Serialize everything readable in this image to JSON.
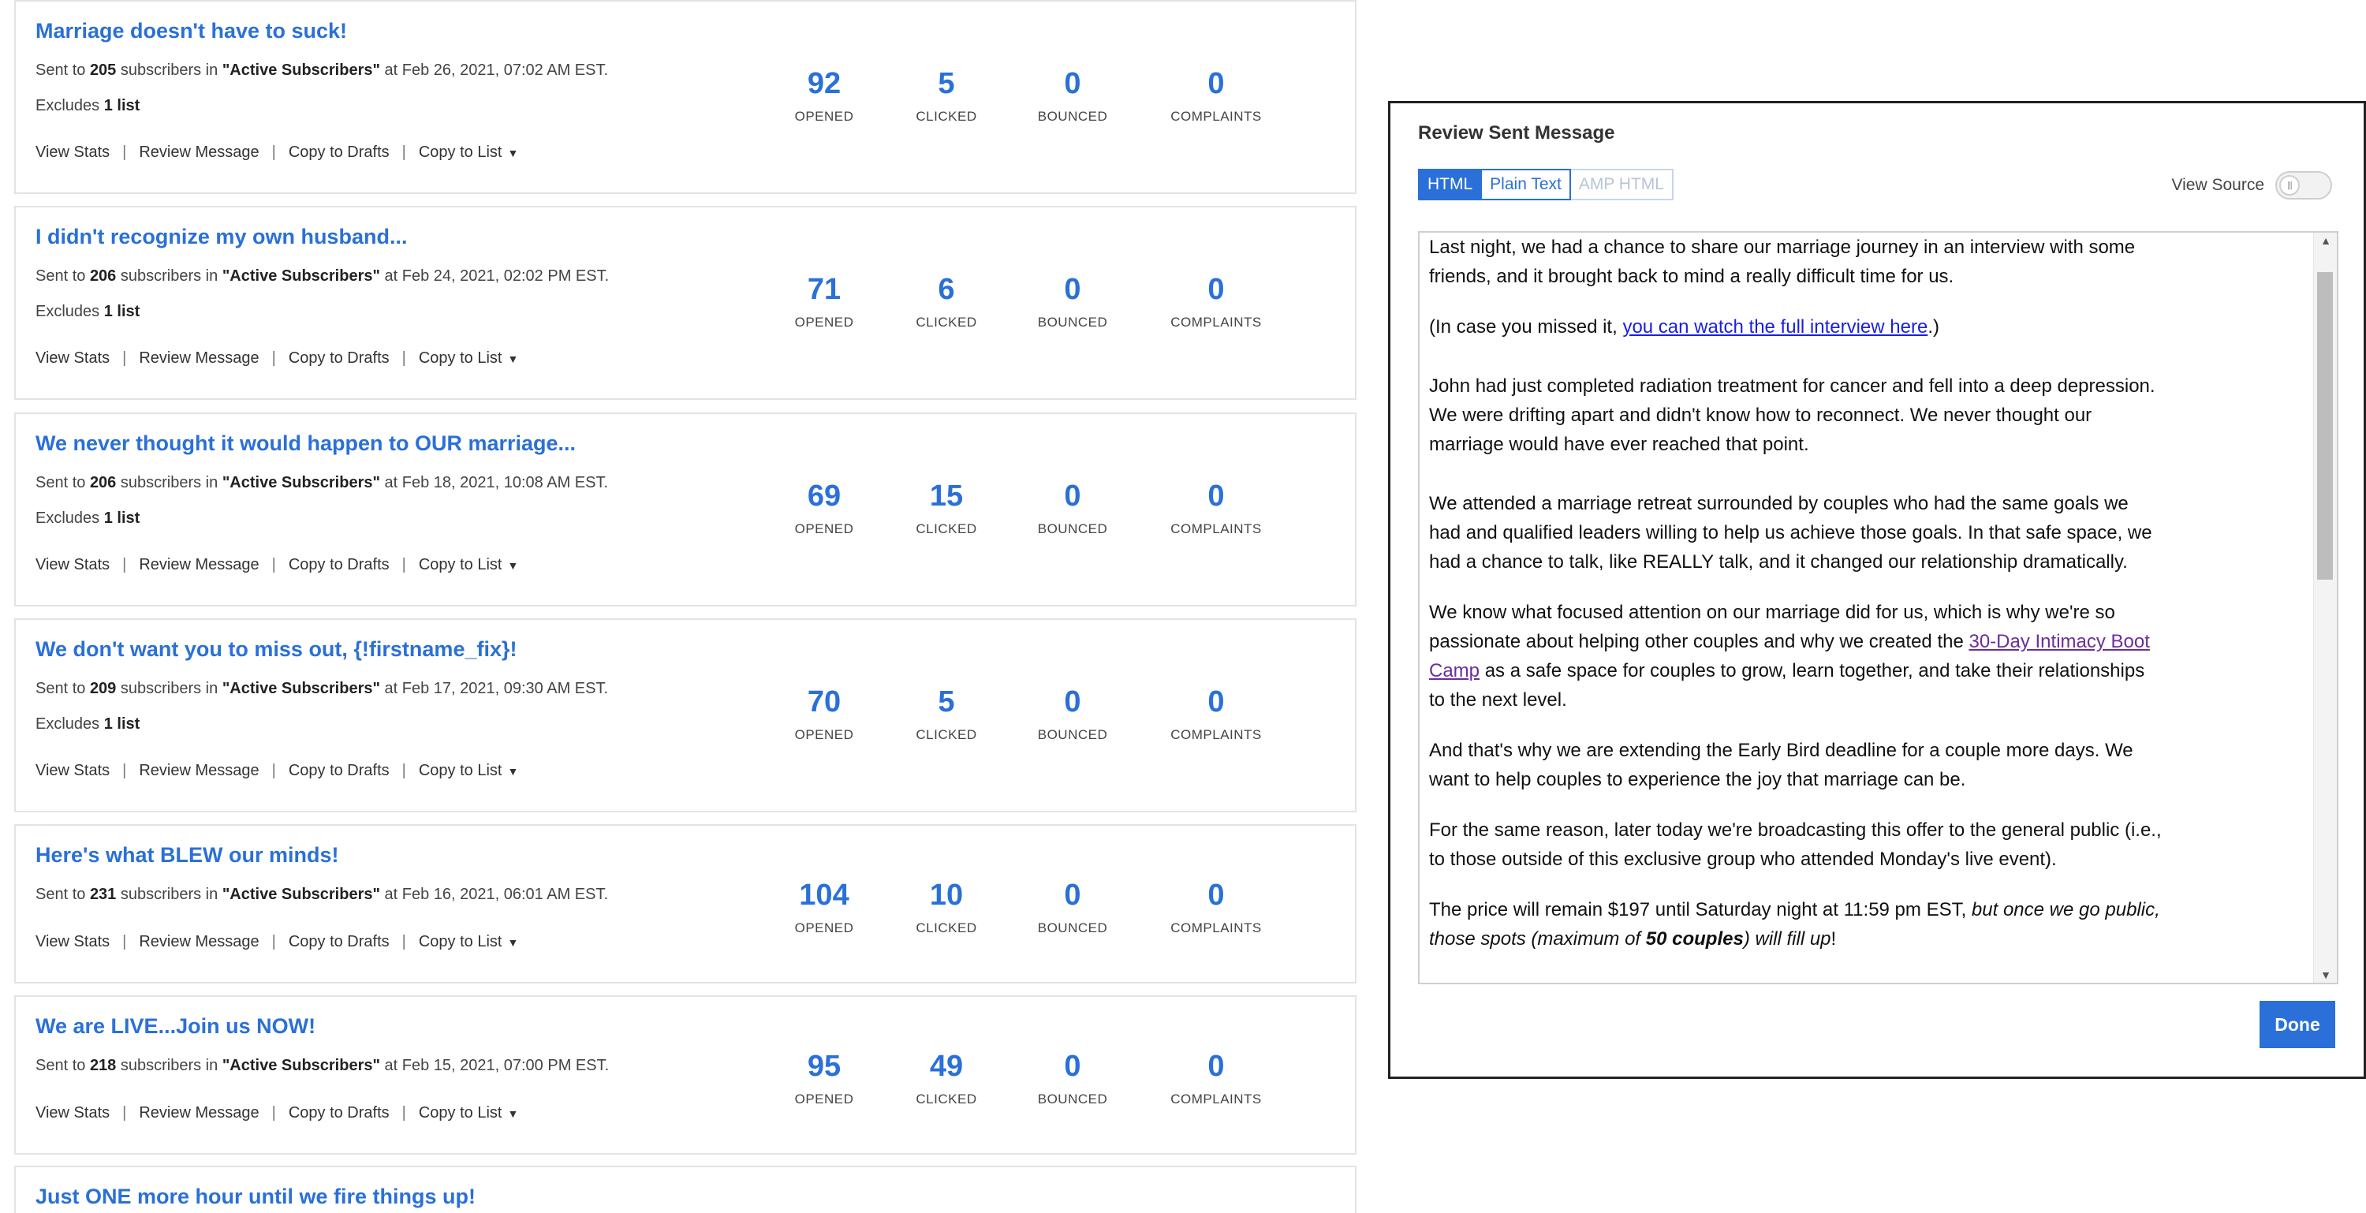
{
  "messages": [
    {
      "title": "Marriage doesn't have to suck!",
      "sent_prefix": "Sent to ",
      "count": "205",
      "mid": " subscribers in ",
      "list": "\"Active Subscribers\"",
      "date": " at Feb 26, 2021, 07:02 AM EST.",
      "excludes_prefix": "Excludes ",
      "excludes": "1 list",
      "opened": "92",
      "clicked": "5",
      "bounced": "0",
      "complaints": "0"
    },
    {
      "title": "I didn't recognize my own husband...",
      "sent_prefix": "Sent to ",
      "count": "206",
      "mid": " subscribers in ",
      "list": "\"Active Subscribers\"",
      "date": " at Feb 24, 2021, 02:02 PM EST.",
      "excludes_prefix": "Excludes ",
      "excludes": "1 list",
      "opened": "71",
      "clicked": "6",
      "bounced": "0",
      "complaints": "0"
    },
    {
      "title": "We never thought it would happen to OUR marriage...",
      "sent_prefix": "Sent to ",
      "count": "206",
      "mid": " subscribers in ",
      "list": "\"Active Subscribers\"",
      "date": " at Feb 18, 2021, 10:08 AM EST.",
      "excludes_prefix": "Excludes ",
      "excludes": "1 list",
      "opened": "69",
      "clicked": "15",
      "bounced": "0",
      "complaints": "0"
    },
    {
      "title": "We don't want you to miss out, {!firstname_fix}!",
      "sent_prefix": "Sent to ",
      "count": "209",
      "mid": " subscribers in ",
      "list": "\"Active Subscribers\"",
      "date": " at Feb 17, 2021, 09:30 AM EST.",
      "excludes_prefix": "Excludes ",
      "excludes": "1 list",
      "opened": "70",
      "clicked": "5",
      "bounced": "0",
      "complaints": "0"
    },
    {
      "title": "Here's what BLEW our minds!",
      "sent_prefix": "Sent to ",
      "count": "231",
      "mid": " subscribers in ",
      "list": "\"Active Subscribers\"",
      "date": " at Feb 16, 2021, 06:01 AM EST.",
      "opened": "104",
      "clicked": "10",
      "bounced": "0",
      "complaints": "0"
    },
    {
      "title": "We are LIVE...Join us NOW!",
      "sent_prefix": "Sent to ",
      "count": "218",
      "mid": " subscribers in ",
      "list": "\"Active Subscribers\"",
      "date": " at Feb 15, 2021, 07:00 PM EST.",
      "opened": "95",
      "clicked": "49",
      "bounced": "0",
      "complaints": "0"
    },
    {
      "title": "Just ONE more hour until we fire things up!"
    }
  ],
  "stat_labels": {
    "opened": "OPENED",
    "clicked": "CLICKED",
    "bounced": "BOUNCED",
    "complaints": "COMPLAINTS"
  },
  "actions": {
    "view_stats": "View Stats",
    "review_message": "Review Message",
    "copy_to_drafts": "Copy to Drafts",
    "copy_to_list": "Copy to List",
    "separator": "|"
  },
  "modal": {
    "title": "Review Sent Message",
    "tabs": [
      "HTML",
      "Plain Text",
      "AMP HTML"
    ],
    "view_source_label": "View Source",
    "done_label": "Done",
    "content": {
      "p1": "Last night, we had a chance to share our marriage journey in an interview with some friends, and it brought back to mind a really difficult time for us.",
      "p2_pre": "(In case you missed it, ",
      "p2_link": "you can watch the full interview here",
      "p2_post": ".)",
      "p3": "John had just completed radiation treatment for cancer and fell into a deep depression. We were drifting apart and didn't know how to reconnect. We never thought our marriage would have ever reached that point.",
      "p4": "We attended a marriage retreat surrounded by couples who had the same goals we had and qualified leaders willing to help us achieve those goals. In that safe space, we had a chance to talk, like REALLY talk, and it changed our relationship dramatically.",
      "p5_pre": "We know what focused attention on our marriage did for us, which is why we're so passionate about helping other couples and why we created the ",
      "p5_link": "30-Day Intimacy Boot Camp",
      "p5_post": " as a safe space for couples to grow, learn together, and take their relationships to the next level.",
      "p6": "And that's why we are extending the Early Bird deadline for a couple more days. We want to help couples to experience the joy that marriage can be.",
      "p7": "For the same reason, later today we're broadcasting this offer to the general public (i.e., to those outside of this exclusive group who attended Monday's live event).",
      "p8_pre": "The price will remain $197 until Saturday night at 11:59 pm EST, ",
      "p8_italic": "but once we go public, those spots (maximum of ",
      "p8_bold": "50 couples",
      "p8_italic2": ") will fill up",
      "p8_post": "!"
    }
  }
}
